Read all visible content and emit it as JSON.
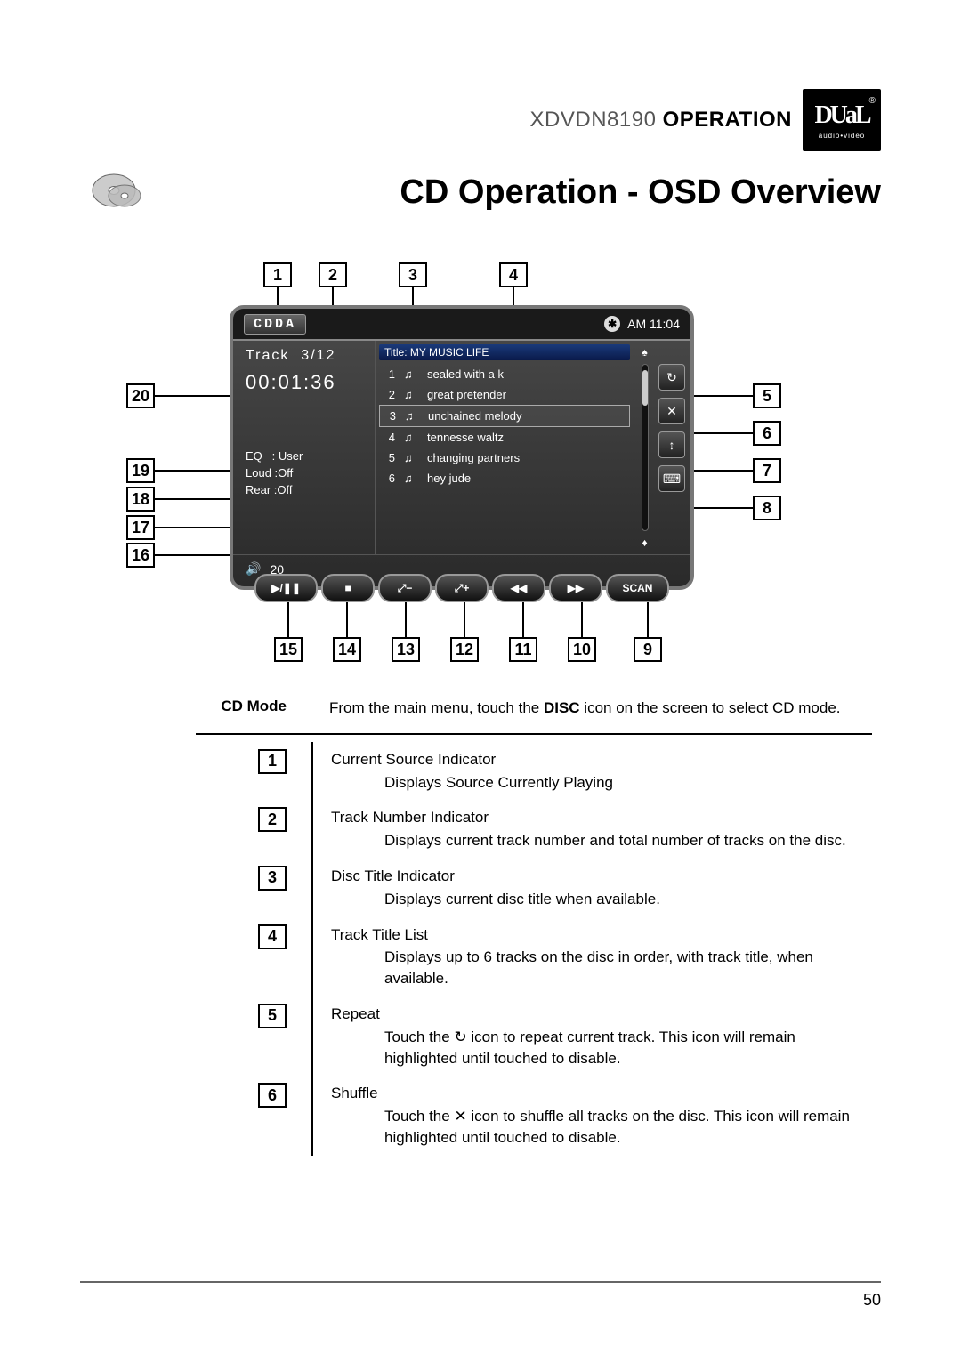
{
  "header": {
    "model": "XDVDN8190",
    "section": "OPERATION",
    "logo_top": "DUaL",
    "logo_bot": "audio•video"
  },
  "title": "CD Operation - OSD Overview",
  "page_number": "50",
  "screen": {
    "source": "CDDA",
    "clock": "AM 11:04",
    "track_indicator_label": "Track",
    "track_indicator_value": "3/12",
    "time": "00:01:36",
    "title_label": "Title:",
    "disc_title": "MY  MUSIC LIFE",
    "eq_label": "EQ",
    "eq_value": ": User",
    "loud_label": "Loud :",
    "loud_value": "Off",
    "rear_label": "Rear :",
    "rear_value": "Off",
    "volume": "20",
    "tracks": [
      {
        "n": "1",
        "title": "sealed with a k"
      },
      {
        "n": "2",
        "title": "great pretender"
      },
      {
        "n": "3",
        "title": "unchained melody"
      },
      {
        "n": "4",
        "title": "tennesse waltz"
      },
      {
        "n": "5",
        "title": "changing partners"
      },
      {
        "n": "6",
        "title": "hey jude"
      }
    ],
    "selected_index": 2,
    "side_buttons": {
      "repeat": "↻",
      "shuffle": "✕",
      "dir": "↕",
      "keyboard": "⌨"
    },
    "controls": {
      "playpause": "▶/❚❚",
      "stop": "■",
      "zoom_out": "⤢−",
      "zoom_in": "⤢+",
      "prev": "◀◀",
      "next": "▶▶",
      "scan": "SCAN"
    }
  },
  "callouts": {
    "top": [
      "1",
      "2",
      "3",
      "4"
    ],
    "right": [
      "5",
      "6",
      "7",
      "8"
    ],
    "left": [
      "20",
      "19",
      "18",
      "17",
      "16"
    ],
    "bottom": [
      "15",
      "14",
      "13",
      "12",
      "11",
      "10",
      "9"
    ]
  },
  "desc": {
    "cd_mode_label": "CD Mode",
    "cd_mode_text_pre": "From the main menu, touch the ",
    "cd_mode_text_bold": "DISC",
    "cd_mode_text_post": " icon on the screen to select CD mode.",
    "items": [
      {
        "n": "1",
        "head": "Current Source Indicator",
        "sub": "Displays Source Currently Playing"
      },
      {
        "n": "2",
        "head": "Track Number Indicator",
        "sub": "Displays current track number and total number of tracks on the disc."
      },
      {
        "n": "3",
        "head": "Disc Title Indicator",
        "sub": "Displays current disc title when available."
      },
      {
        "n": "4",
        "head": "Track Title List",
        "sub": "Displays up to 6 tracks on the disc in order, with track title, when available."
      },
      {
        "n": "5",
        "head": "Repeat",
        "sub": "Touch the ↻ icon to repeat current track. This icon will remain highlighted until touched to disable."
      },
      {
        "n": "6",
        "head": "Shuffle",
        "sub": "Touch the ✕ icon to shuffle all tracks on the disc. This icon will remain highlighted until touched to disable."
      }
    ]
  }
}
